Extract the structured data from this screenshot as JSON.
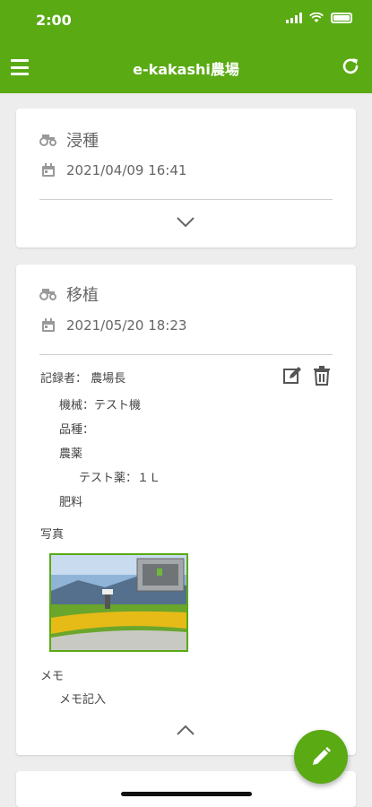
{
  "status_bar": {
    "time": "2:00"
  },
  "app_bar": {
    "title": "e-kakashi農場"
  },
  "cards": [
    {
      "work": "浸種",
      "datetime": "2021/04/09 16:41"
    },
    {
      "work": "移植",
      "datetime": "2021/05/20 18:23",
      "recorder": "記録者： 農場長",
      "machine": "機械：テスト機",
      "variety": "品種：",
      "pesticide_label": "農薬",
      "pesticide_item": "テスト薬：１Ｌ",
      "fertilizer_label": "肥料",
      "photo_label": "写真",
      "memo_label": "メモ",
      "memo_text": "メモ記入"
    }
  ],
  "colors": {
    "brand": "#5aaa14",
    "background": "#ededed",
    "card": "#ffffff"
  }
}
